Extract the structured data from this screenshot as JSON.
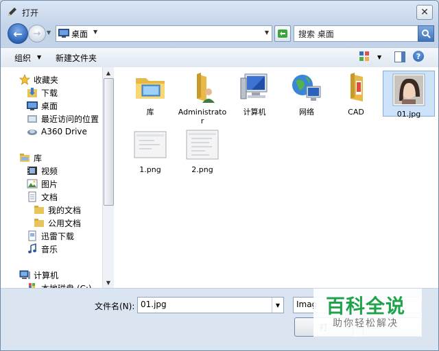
{
  "window": {
    "title": "打开",
    "close_glyph": "✕"
  },
  "nav": {
    "back_glyph": "←",
    "forward_glyph": "→",
    "address": "桌面",
    "search_placeholder": "搜索 桌面"
  },
  "toolbar": {
    "organize": "组织",
    "new_folder": "新建文件夹",
    "help_glyph": "?"
  },
  "sidebar": {
    "favorites_header": "收藏夹",
    "favorites": [
      "下载",
      "桌面",
      "最近访问的位置",
      "A360 Drive"
    ],
    "libraries_header": "库",
    "libraries": [
      "视频",
      "图片",
      "文档"
    ],
    "documents_sub": [
      "我的文档",
      "公用文档"
    ],
    "others": [
      "迅雷下载",
      "音乐"
    ],
    "computer_header": "计算机",
    "computer_items": [
      "本地磁盘 (C:)"
    ]
  },
  "files": [
    {
      "name": "库",
      "icon": "library-folder-icon"
    },
    {
      "name": "Administrator",
      "icon": "user-folder-icon"
    },
    {
      "name": "计算机",
      "icon": "computer-icon"
    },
    {
      "name": "网络",
      "icon": "network-icon"
    },
    {
      "name": "CAD",
      "icon": "folder-icon"
    },
    {
      "name": "01.jpg",
      "icon": "image-thumbnail",
      "selected": true
    },
    {
      "name": "1.png",
      "icon": "image-thumbnail"
    },
    {
      "name": "2.png",
      "icon": "image-thumbnail"
    }
  ],
  "bottom": {
    "filename_label": "文件名(N):",
    "filename_value": "01.jpg",
    "filetype_value": "Imag",
    "open_button": "打"
  },
  "watermark": {
    "title": "百科全说",
    "subtitle": "助你轻松解决"
  },
  "colors": {
    "selection": "#cde3f9",
    "watermark_green": "#1ea34a",
    "accent_blue": "#2d62b5"
  }
}
